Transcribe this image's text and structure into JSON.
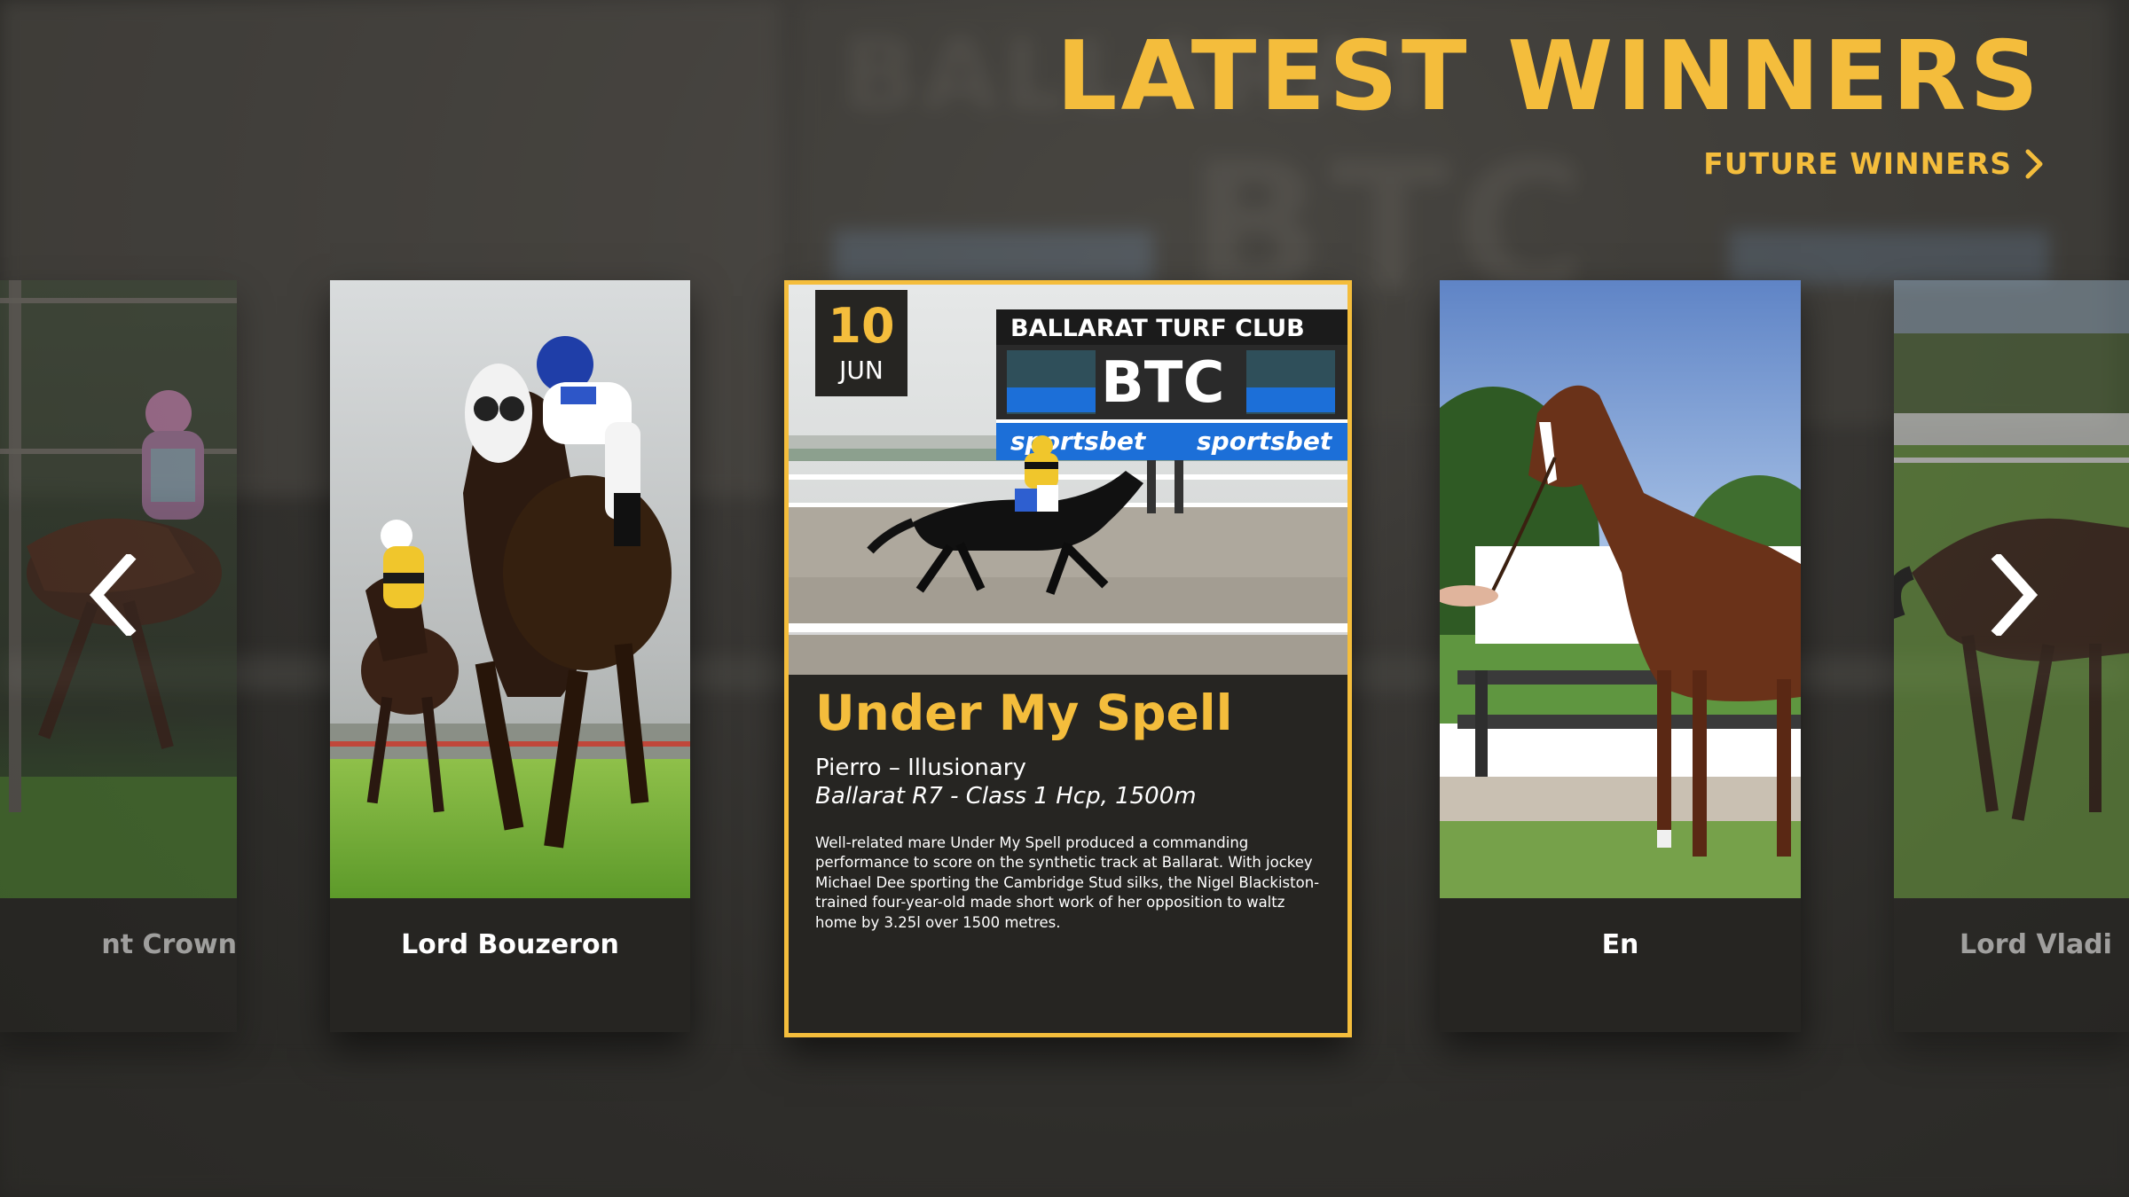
{
  "header": {
    "title": "LATEST WINNERS",
    "future_link": "FUTURE WINNERS",
    "future_icon": "chevron-right-icon"
  },
  "colors": {
    "accent": "#f4bd3c",
    "card_bg": "#262522",
    "text": "#ffffff"
  },
  "backdrop": {
    "sign_word": "BALLARAT",
    "sign_letters": "BTC"
  },
  "carousel": {
    "prev_icon": "chevron-left-icon",
    "next_icon": "chevron-right-icon",
    "cards": [
      {
        "name": "nt Crown"
      },
      {
        "name": "Lord Bouzeron"
      },
      {
        "day": "10",
        "month": "JUN",
        "title": "Under My Spell",
        "pedigree": "Pierro – Illusionary",
        "race": "Ballarat R7 - Class 1 Hcp, 1500m",
        "description": "Well-related mare Under My Spell produced a commanding performance to score on the synthetic track at Ballarat. With jockey Michael Dee sporting the Cambridge Stud silks, the Nigel Blackiston-trained four-year-old made short work of her opposition to waltz home by 3.25l over 1500 metres.",
        "photo": {
          "sign_title": "BALLARAT TURF CLUB",
          "sign_letters": "BTC",
          "sponsor": "sportsbet"
        }
      },
      {
        "name": "En"
      },
      {
        "name": "Lord Vladi"
      }
    ]
  }
}
